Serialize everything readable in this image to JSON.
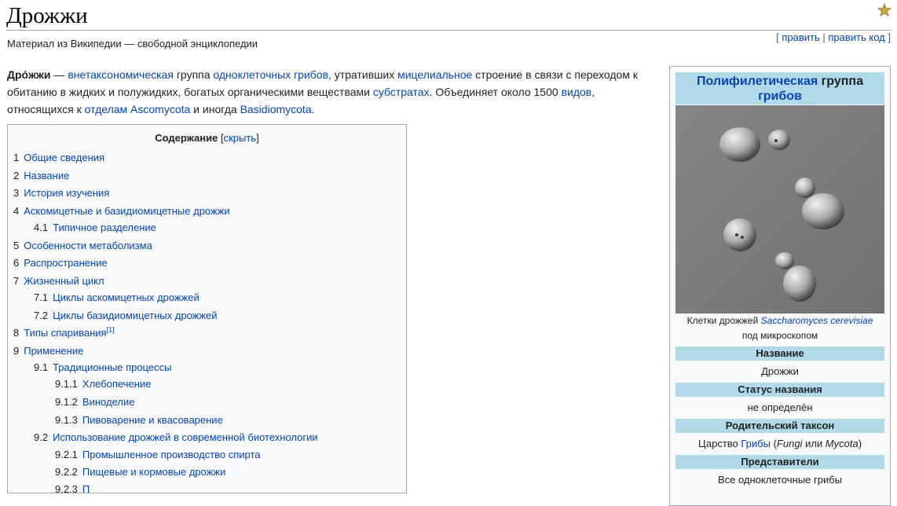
{
  "page": {
    "title": "Дрожжи",
    "tagline": "Материал из Википедии — свободной энциклопедии",
    "edit_links": {
      "open": "[ ",
      "edit": "править",
      "sep": " | ",
      "edit_code": "править код",
      "close": " ]"
    },
    "star_icon": "featured-star-icon"
  },
  "intro": {
    "bold": "Дро́жжи",
    "t1": " — ",
    "l1": "внетаксономическая",
    "t2": " группа ",
    "l2": "одноклеточных",
    "t3": " ",
    "l3": "грибов",
    "t4": ", утративших ",
    "l4": "мицелиальное",
    "t5": " строение в связи с переходом к обитанию в жидких и полужидких, богатых органическими веществами ",
    "l5": "субстратах",
    "t6": ". Объединяет около 1500 ",
    "l6": "видов",
    "t7": ", относящихся к ",
    "l7": "отделам",
    "t8": " ",
    "l8": "Ascomycota",
    "t9": " и иногда ",
    "l9": "Basidiomycota",
    "t10": "."
  },
  "toc": {
    "title": "Содержание",
    "toggle_open": " [",
    "toggle": "скрыть",
    "toggle_close": "]",
    "items": [
      {
        "num": "1",
        "text": "Общие сведения"
      },
      {
        "num": "2",
        "text": "Название"
      },
      {
        "num": "3",
        "text": "История изучения"
      },
      {
        "num": "4",
        "text": "Аскомицетные и базидиомицетные дрожжи"
      },
      {
        "num": "4.1",
        "text": "Типичное разделение"
      },
      {
        "num": "5",
        "text": "Особенности метаболизма"
      },
      {
        "num": "6",
        "text": "Распространение"
      },
      {
        "num": "7",
        "text": "Жизненный цикл"
      },
      {
        "num": "7.1",
        "text": "Циклы аскомицетных дрожжей"
      },
      {
        "num": "7.2",
        "text": "Циклы базидиомицетных дрожжей"
      },
      {
        "num": "8",
        "text": "Типы спаривания",
        "sup": "[1]"
      },
      {
        "num": "9",
        "text": "Применение"
      },
      {
        "num": "9.1",
        "text": "Традиционные процессы"
      },
      {
        "num": "9.1.1",
        "text": "Хлебопечение"
      },
      {
        "num": "9.1.2",
        "text": "Виноделие"
      },
      {
        "num": "9.1.3",
        "text": "Пивоварение и квасоварение"
      },
      {
        "num": "9.2",
        "text": "Использование дрожжей в современной биотехнологии"
      },
      {
        "num": "9.2.1",
        "text": "Промышленное производство спирта"
      },
      {
        "num": "9.2.2",
        "text": "Пищевые и кормовые дрожжи"
      },
      {
        "num": "9.2.3",
        "text": "П"
      }
    ]
  },
  "infobox": {
    "header_link": "Полифилетическая",
    "header_rest": " группа",
    "header_link2": "грибов",
    "caption_pre": "Клетки дрожжей ",
    "caption_link": "Saccharomyces cerevisiae",
    "caption_post": " под микроскопом",
    "rows": [
      {
        "label": "Название",
        "value": "Дрожжи"
      },
      {
        "label": "Статус названия",
        "value": "не определён"
      },
      {
        "label": "Родительский таксон",
        "value_pre": "Царство ",
        "value_link": "Грибы",
        "value_mid": " (",
        "value_i1": "Fungi",
        "value_mid2": " или ",
        "value_i2": "Mycota",
        "value_post": ")"
      },
      {
        "label": "Представители",
        "value": "Все одноклеточные грибы"
      }
    ]
  }
}
